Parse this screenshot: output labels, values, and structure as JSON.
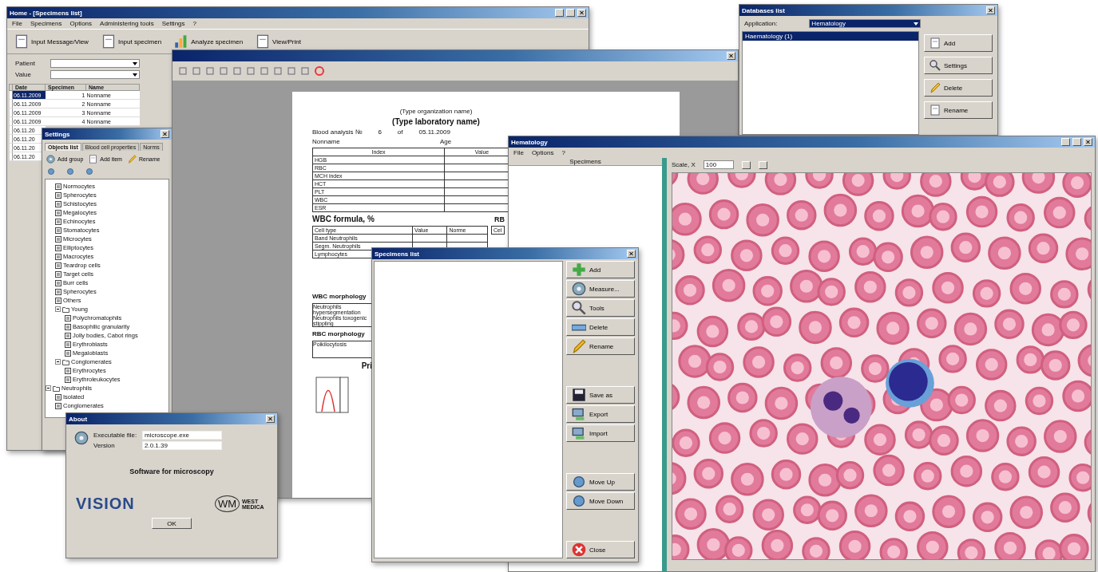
{
  "main_window": {
    "title": "Home - [Specimens list]",
    "menu": [
      "File",
      "Specimens",
      "Options",
      "Administering tools",
      "Settings",
      "?"
    ],
    "toolbar": [
      "Input Message/View",
      "Input specimen",
      "Analyze specimen",
      "View/Print"
    ],
    "filters": [
      {
        "label": "Patient"
      },
      {
        "label": "Value"
      }
    ],
    "columns": [
      "Date",
      "Specimen",
      "Name"
    ],
    "rows": [
      {
        "date": "06.11.2009",
        "number": "1",
        "name": "Nonname",
        "selected": true
      },
      {
        "date": "06.11.2009",
        "number": "2",
        "name": "Nonname",
        "selected": false
      },
      {
        "date": "06.11.2009",
        "number": "3",
        "name": "Nonname",
        "selected": false
      },
      {
        "date": "06.11.2009",
        "number": "4",
        "name": "Nonname",
        "selected": false
      }
    ],
    "partial_rows": [
      "06.11.20",
      "06.11.20",
      "06.11.20",
      "06.11.20"
    ]
  },
  "settings_window": {
    "title": "Settings",
    "tabs": [
      {
        "label": "Objects list",
        "selected": true
      },
      {
        "label": "Blood cell properties",
        "selected": false
      },
      {
        "label": "Norms",
        "selected": false
      }
    ],
    "buttons": [
      "Add group",
      "Add item",
      "Rename"
    ],
    "tree": [
      {
        "children": [
          {
            "label": "Normocytes"
          },
          {
            "label": "Spherocytes"
          },
          {
            "label": "Schistocytes"
          },
          {
            "label": "Megalocytes"
          },
          {
            "label": "Echinocytes"
          },
          {
            "label": "Stomatocytes"
          },
          {
            "label": "Microcytes"
          },
          {
            "label": "Elliptocytes"
          },
          {
            "label": "Macrocytes"
          },
          {
            "label": "Teardrop cells"
          },
          {
            "label": "Target cells"
          },
          {
            "label": "Burr cells"
          },
          {
            "label": "Spherocytes"
          },
          {
            "label": "Others"
          },
          {
            "label": "Young",
            "expanded": true,
            "children": [
              {
                "label": "Polychromatophils"
              },
              {
                "label": "Basophilic granularity"
              },
              {
                "label": "Jolly bodies, Cabot rings"
              },
              {
                "label": "Erythroblasts"
              },
              {
                "label": "Megaloblasts"
              }
            ]
          },
          {
            "label": "Conglomerates",
            "expanded": true,
            "children": [
              {
                "label": "Erythrocytes"
              },
              {
                "label": "Erythroleukocytes"
              }
            ]
          }
        ]
      },
      {
        "label": "Neutrophils",
        "expanded": true,
        "children": [
          {
            "label": "Isolated"
          },
          {
            "label": "Conglomerates"
          }
        ]
      }
    ]
  },
  "report_window": {
    "organization": "(Type organization name)",
    "laboratory": "(Type laboratory name)",
    "analysis_label": "Blood analysis №",
    "analysis_number": "6",
    "of": "of",
    "date": "05.11.2009",
    "patient": "Nonname",
    "age_label": "Age",
    "index_columns": [
      "Index",
      "Value"
    ],
    "index_rows": [
      "HGB",
      "RBC",
      "MCH index",
      "HCT",
      "PLT",
      "WBC",
      "ESR"
    ],
    "wbc_title": "WBC formula, %",
    "rbc_title": "RB",
    "formula_columns": [
      "Cell type",
      "Value",
      "Norme"
    ],
    "side_header": "Cel",
    "formula_rows": [
      "Band Neutrophils",
      "Segm. Neutrophils",
      "Lymphocytes"
    ],
    "wbc_morphology": "WBC morphology",
    "wbc_items": [
      "Neutrophils hypersegmentation",
      "Neutrophils toxogenic stippling"
    ],
    "rbc_morphology": "RBC morphology",
    "rbc_items": [
      "Poikilocytosis"
    ],
    "print_title": "Pri"
  },
  "databases_window": {
    "title": "Databases list",
    "application_label": "Application:",
    "application_value": "Hematology",
    "items": [
      {
        "label": "Haematology (1)",
        "selected": true
      }
    ],
    "buttons": [
      "Add",
      "Settings",
      "Delete",
      "Rename"
    ]
  },
  "hematology_window": {
    "title": "Hematology",
    "menu": [
      "File",
      "Options",
      "?"
    ],
    "pane_header": "Specimens",
    "scale_label": "Scale, X",
    "scale_value": "100"
  },
  "specimens_window": {
    "title": "Specimens list",
    "button_groups": [
      [
        "Add",
        "Measure...",
        "Tools",
        "Delete",
        "Rename"
      ],
      [
        "Save as",
        "Export",
        "Import"
      ],
      [
        "Move Up",
        "Move Down"
      ],
      [
        "Close"
      ]
    ]
  },
  "about_window": {
    "title": "About",
    "fields": [
      {
        "label": "Executable file:",
        "value": "microscope.exe"
      },
      {
        "label": "Version",
        "value": "2.0.1.39"
      }
    ],
    "tagline": "Software for microscopy",
    "product_logo": "VISION",
    "company_mark": "WM",
    "company_name": "WEST MEDICA",
    "ok": "OK"
  }
}
